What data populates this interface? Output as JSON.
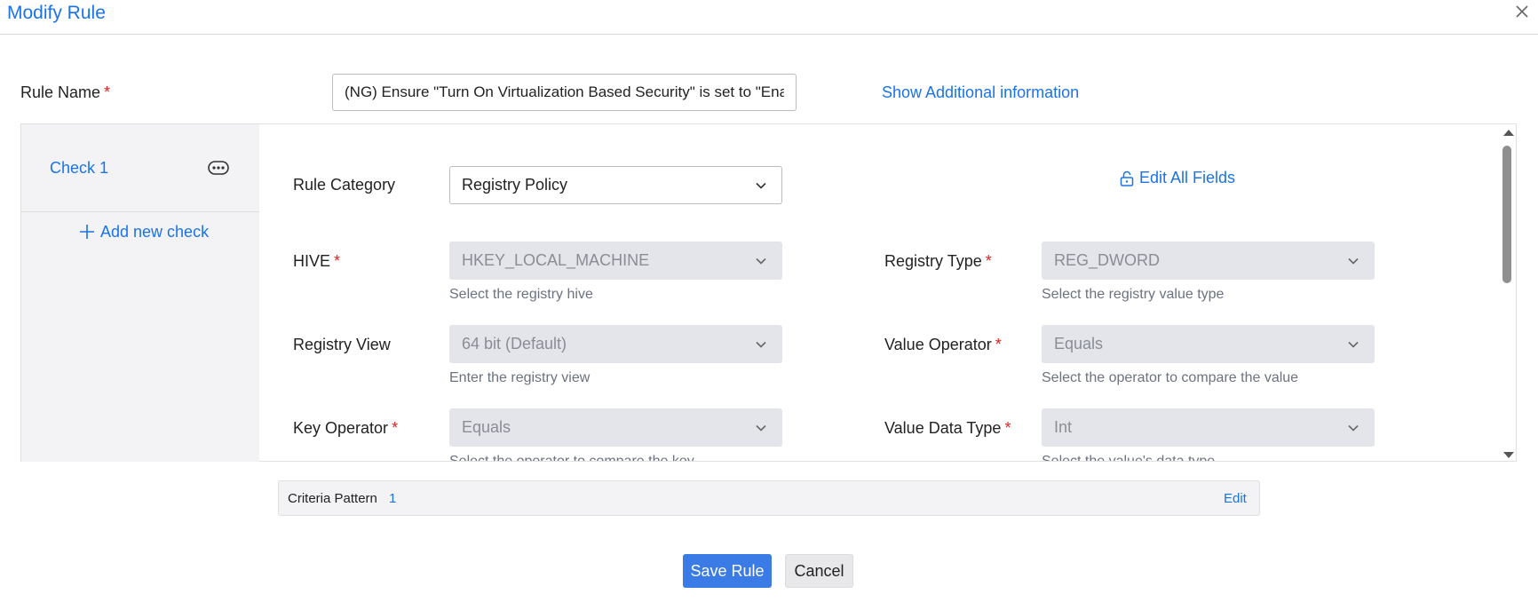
{
  "dialog": {
    "title": "Modify Rule",
    "close_icon": "close-icon"
  },
  "rule_name": {
    "label": "Rule Name",
    "required_mark": "*",
    "value": "(NG) Ensure \"Turn On Virtualization Based Security\" is set to \"Enable",
    "show_info_link": "Show Additional information"
  },
  "checks": {
    "items": [
      {
        "label": "Check 1",
        "menu_icon": "more-options-icon"
      }
    ],
    "add_label": "Add new check",
    "add_icon": "plus-icon"
  },
  "form": {
    "rule_category": {
      "label": "Rule Category",
      "value": "Registry Policy"
    },
    "edit_all": {
      "label": "Edit All Fields",
      "icon": "unlock-icon"
    },
    "hive": {
      "label": "HIVE",
      "required_mark": "*",
      "value": "HKEY_LOCAL_MACHINE",
      "hint": "Select the registry hive"
    },
    "registry_type": {
      "label": "Registry Type",
      "required_mark": "*",
      "value": "REG_DWORD",
      "hint": "Select the registry value type"
    },
    "registry_view": {
      "label": "Registry View",
      "value": "64 bit (Default)",
      "hint": "Enter the registry view"
    },
    "value_operator": {
      "label": "Value Operator",
      "required_mark": "*",
      "value": "Equals",
      "hint": "Select the operator to compare the value"
    },
    "key_operator": {
      "label": "Key Operator",
      "required_mark": "*",
      "value": "Equals",
      "hint": "Select the operator to compare the key"
    },
    "value_data_type": {
      "label": "Value Data Type",
      "required_mark": "*",
      "value": "Int",
      "hint": "Select the value's data type"
    }
  },
  "criteria": {
    "label": "Criteria Pattern",
    "value": "1",
    "edit_label": "Edit"
  },
  "actions": {
    "save_label": "Save Rule",
    "cancel_label": "Cancel"
  },
  "colors": {
    "accent": "#1a73e8",
    "primary_button": "#3b7be6",
    "required": "#e02020",
    "disabled_field": "#e4e5ea"
  }
}
